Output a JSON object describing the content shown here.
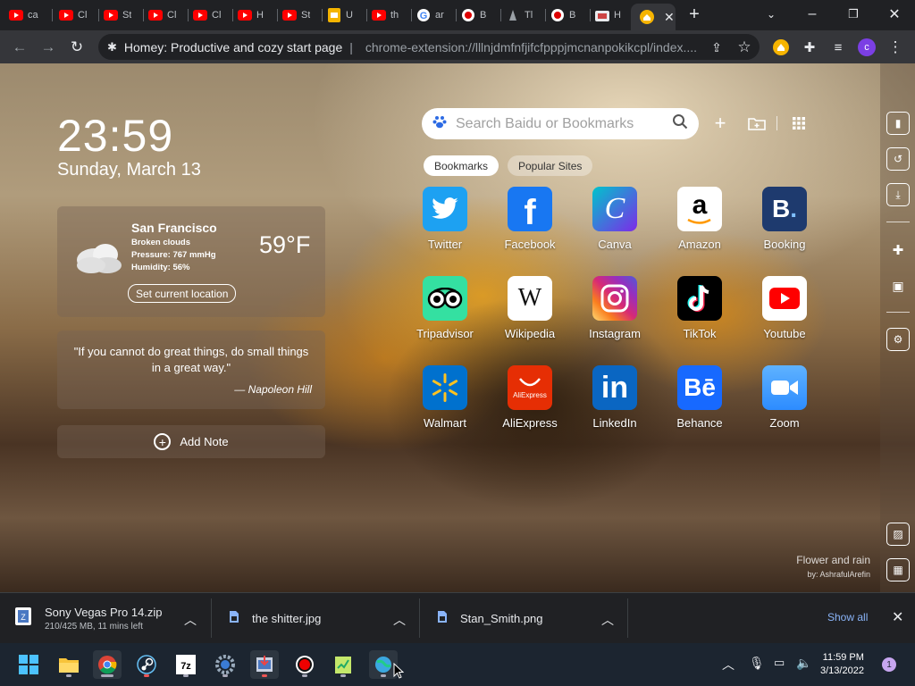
{
  "browser": {
    "tabs": [
      {
        "label": "ca",
        "icon": "youtube-icon"
      },
      {
        "label": "Cl",
        "icon": "youtube-icon"
      },
      {
        "label": "St",
        "icon": "youtube-icon"
      },
      {
        "label": "Cl",
        "icon": "youtube-icon"
      },
      {
        "label": "Cl",
        "icon": "youtube-icon"
      },
      {
        "label": "H",
        "icon": "youtube-icon"
      },
      {
        "label": "St",
        "icon": "youtube-icon"
      },
      {
        "label": "U",
        "icon": "slides-icon"
      },
      {
        "label": "th",
        "icon": "youtube-icon"
      },
      {
        "label": "ar",
        "icon": "google-icon"
      },
      {
        "label": "B",
        "icon": "record-icon"
      },
      {
        "label": "Tl",
        "icon": "puppet-icon"
      },
      {
        "label": "B",
        "icon": "record-icon"
      },
      {
        "label": "H",
        "icon": "homey-icon"
      }
    ],
    "active_tab": {
      "icon": "homey-icon"
    },
    "new_tab_label": "+",
    "address": {
      "page_title": "Homey: Productive and cozy start page",
      "separator": "|",
      "url": "chrome-extension://lllnjdmfnfjifcfpppjmcnanpokikcpl/index...."
    },
    "profile_initial": "c"
  },
  "page": {
    "time": "23:59",
    "date": "Sunday, March 13",
    "weather": {
      "city": "San Francisco",
      "condition": "Broken clouds",
      "pressure": "Pressure: 767 mmHg",
      "humidity": "Humidity: 56%",
      "temp": "59°F",
      "set_location": "Set current location"
    },
    "quote": {
      "text": "\"If you cannot do great things, do small things in a great way.\"",
      "author": "— Napoleon Hill"
    },
    "add_note": "Add Note",
    "search_placeholder": "Search Baidu or Bookmarks",
    "tabs": {
      "bookmarks": "Bookmarks",
      "popular": "Popular Sites"
    },
    "sites": [
      {
        "name": "Twitter",
        "bg": "#1da1f2"
      },
      {
        "name": "Facebook",
        "bg": "#1877f2"
      },
      {
        "name": "Canva",
        "bg": "#7d2ae8"
      },
      {
        "name": "Amazon",
        "bg": "#ffffff"
      },
      {
        "name": "Booking",
        "bg": "#1e3a6e"
      },
      {
        "name": "Tripadvisor",
        "bg": "#34e0a1"
      },
      {
        "name": "Wikipedia",
        "bg": "#ffffff"
      },
      {
        "name": "Instagram",
        "bg": "#d62976"
      },
      {
        "name": "TikTok",
        "bg": "#000000"
      },
      {
        "name": "Youtube",
        "bg": "#ffffff"
      },
      {
        "name": "Walmart",
        "bg": "#0071ce"
      },
      {
        "name": "AliExpress",
        "bg": "#e62e04"
      },
      {
        "name": "LinkedIn",
        "bg": "#0a66c2"
      },
      {
        "name": "Behance",
        "bg": "#1769ff"
      },
      {
        "name": "Zoom",
        "bg": "#2d8cff"
      }
    ],
    "wallpaper": {
      "title": "Flower and rain",
      "author": "by: AshrafulArefin"
    }
  },
  "downloads": {
    "items": [
      {
        "name": "Sony Vegas Pro 14.zip",
        "status": "210/425 MB, 11 mins left"
      },
      {
        "name": "the shitter.jpg"
      },
      {
        "name": "Stan_Smith.png"
      }
    ],
    "show_all": "Show all"
  },
  "taskbar": {
    "time": "11:59 PM",
    "date": "3/13/2022",
    "notifications": "1",
    "apps": [
      "windows-start-icon",
      "file-explorer-icon",
      "chrome-icon",
      "steam-icon",
      "7zip-icon",
      "settings-icon",
      "app-installer-icon",
      "obs-record-icon",
      "notepad-plus-icon",
      "network-globe-icon"
    ]
  }
}
